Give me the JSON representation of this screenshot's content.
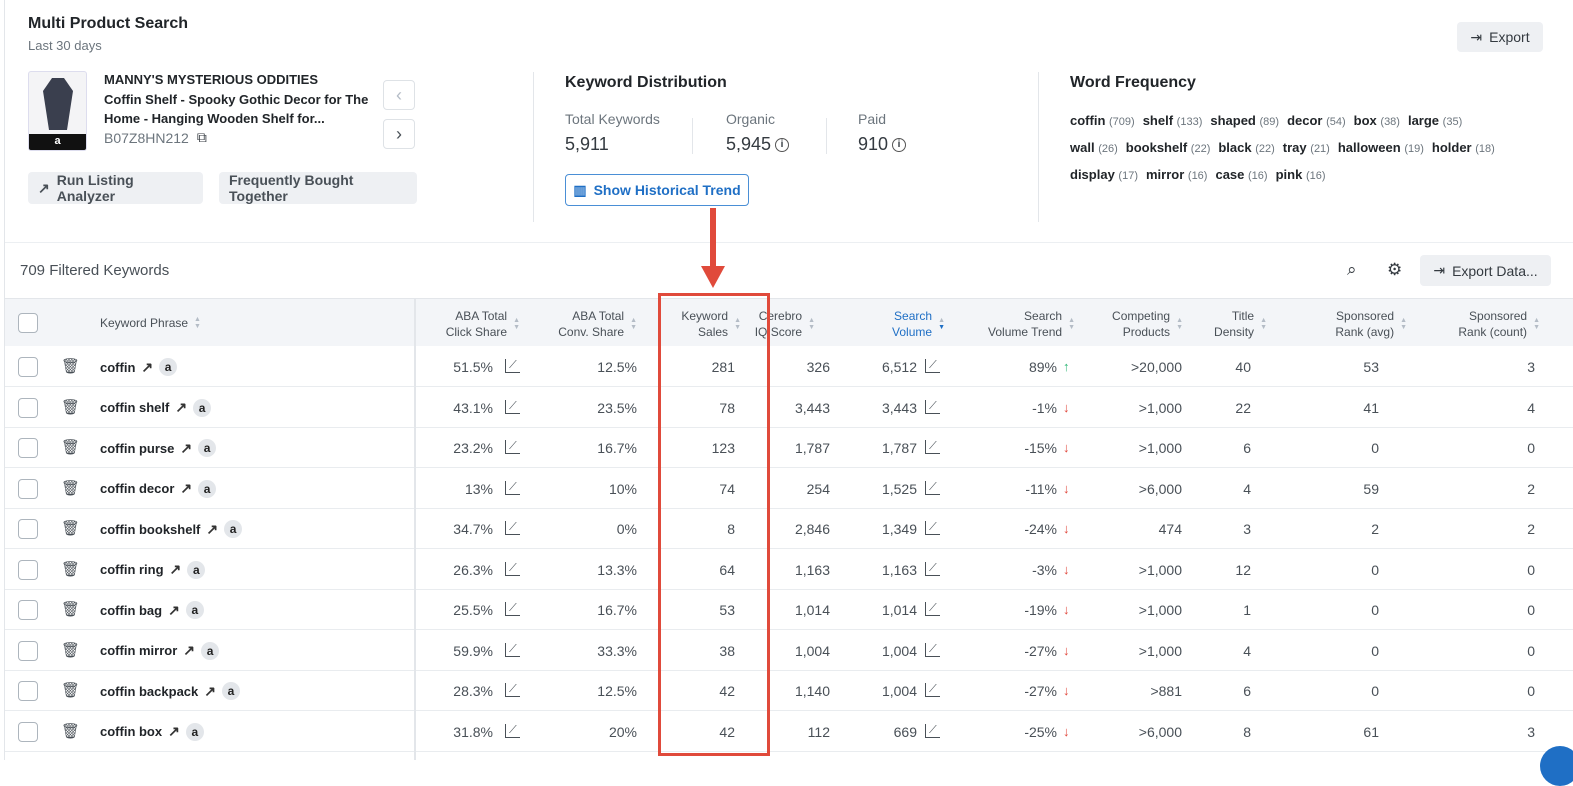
{
  "header": {
    "title": "Multi Product Search",
    "subtitle": "Last 30 days",
    "export_label": "Export"
  },
  "product": {
    "brand": "MANNY'S MYSTERIOUS ODDITIES",
    "title": "Coffin Shelf - Spooky Gothic Decor for The Home - Hanging Wooden Shelf for...",
    "asin": "B07Z8HN212",
    "run_listing_label": "Run Listing Analyzer",
    "fbt_label": "Frequently Bought Together"
  },
  "distribution": {
    "title": "Keyword Distribution",
    "total_label": "Total Keywords",
    "total": "5,911",
    "organic_label": "Organic",
    "organic": "5,945",
    "paid_label": "Paid",
    "paid": "910",
    "history_label": "Show Historical Trend"
  },
  "word_frequency": {
    "title": "Word Frequency",
    "words": [
      {
        "w": "coffin",
        "c": "(709)"
      },
      {
        "w": "shelf",
        "c": "(133)"
      },
      {
        "w": "shaped",
        "c": "(89)"
      },
      {
        "w": "decor",
        "c": "(54)"
      },
      {
        "w": "box",
        "c": "(38)"
      },
      {
        "w": "large",
        "c": "(35)"
      },
      {
        "w": "wall",
        "c": "(26)"
      },
      {
        "w": "bookshelf",
        "c": "(22)"
      },
      {
        "w": "black",
        "c": "(22)"
      },
      {
        "w": "tray",
        "c": "(21)"
      },
      {
        "w": "halloween",
        "c": "(19)"
      },
      {
        "w": "holder",
        "c": "(18)"
      },
      {
        "w": "display",
        "c": "(17)"
      },
      {
        "w": "mirror",
        "c": "(16)"
      },
      {
        "w": "case",
        "c": "(16)"
      },
      {
        "w": "pink",
        "c": "(16)"
      }
    ]
  },
  "toolbar": {
    "filtered": "709 Filtered Keywords",
    "export_data_label": "Export Data..."
  },
  "columns": {
    "phrase": "Keyword Phrase",
    "click": "ABA Total\nClick Share",
    "conv": "ABA Total\nConv. Share",
    "sales": "Keyword\nSales",
    "cerebro": "Cerebro\nIQ Score",
    "volume": "Search\nVolume",
    "trend": "Search\nVolume Trend",
    "competing": "Competing\nProducts",
    "density": "Title\nDensity",
    "spavg": "Sponsored\nRank (avg)",
    "spcount": "Sponsored\nRank (count)"
  },
  "rows": [
    {
      "kw": "coffin",
      "click": "51.5%",
      "conv": "12.5%",
      "sales": "281",
      "cerebro": "326",
      "volume": "6,512",
      "trend": "89%",
      "dir": "up",
      "competing": ">20,000",
      "density": "40",
      "spavg": "53",
      "spcount": "3"
    },
    {
      "kw": "coffin shelf",
      "click": "43.1%",
      "conv": "23.5%",
      "sales": "78",
      "cerebro": "3,443",
      "volume": "3,443",
      "trend": "-1%",
      "dir": "down",
      "competing": ">1,000",
      "density": "22",
      "spavg": "41",
      "spcount": "4"
    },
    {
      "kw": "coffin purse",
      "click": "23.2%",
      "conv": "16.7%",
      "sales": "123",
      "cerebro": "1,787",
      "volume": "1,787",
      "trend": "-15%",
      "dir": "down",
      "competing": ">1,000",
      "density": "6",
      "spavg": "0",
      "spcount": "0"
    },
    {
      "kw": "coffin decor",
      "click": "13%",
      "conv": "10%",
      "sales": "74",
      "cerebro": "254",
      "volume": "1,525",
      "trend": "-11%",
      "dir": "down",
      "competing": ">6,000",
      "density": "4",
      "spavg": "59",
      "spcount": "2"
    },
    {
      "kw": "coffin bookshelf",
      "click": "34.7%",
      "conv": "0%",
      "sales": "8",
      "cerebro": "2,846",
      "volume": "1,349",
      "trend": "-24%",
      "dir": "down",
      "competing": "474",
      "density": "3",
      "spavg": "2",
      "spcount": "2"
    },
    {
      "kw": "coffin ring",
      "click": "26.3%",
      "conv": "13.3%",
      "sales": "64",
      "cerebro": "1,163",
      "volume": "1,163",
      "trend": "-3%",
      "dir": "down",
      "competing": ">1,000",
      "density": "12",
      "spavg": "0",
      "spcount": "0"
    },
    {
      "kw": "coffin bag",
      "click": "25.5%",
      "conv": "16.7%",
      "sales": "53",
      "cerebro": "1,014",
      "volume": "1,014",
      "trend": "-19%",
      "dir": "down",
      "competing": ">1,000",
      "density": "1",
      "spavg": "0",
      "spcount": "0"
    },
    {
      "kw": "coffin mirror",
      "click": "59.9%",
      "conv": "33.3%",
      "sales": "38",
      "cerebro": "1,004",
      "volume": "1,004",
      "trend": "-27%",
      "dir": "down",
      "competing": ">1,000",
      "density": "4",
      "spavg": "0",
      "spcount": "0"
    },
    {
      "kw": "coffin backpack",
      "click": "28.3%",
      "conv": "12.5%",
      "sales": "42",
      "cerebro": "1,140",
      "volume": "1,004",
      "trend": "-27%",
      "dir": "down",
      "competing": ">881",
      "density": "6",
      "spavg": "0",
      "spcount": "0"
    },
    {
      "kw": "coffin box",
      "click": "31.8%",
      "conv": "20%",
      "sales": "42",
      "cerebro": "112",
      "volume": "669",
      "trend": "-25%",
      "dir": "down",
      "competing": ">6,000",
      "density": "8",
      "spavg": "61",
      "spcount": "3"
    }
  ],
  "colors": {
    "accent": "#1f6fc5",
    "up": "#2bb673",
    "down": "#e0463a",
    "highlight": "#e04a3b"
  }
}
